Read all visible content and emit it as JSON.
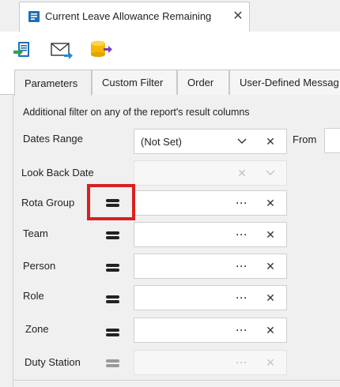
{
  "document_tab": {
    "title": "Current Leave Allowance Remaining",
    "close_glyph": "✕"
  },
  "toolbar": {
    "buttons": [
      {
        "name": "export-icon"
      },
      {
        "name": "email-icon"
      },
      {
        "name": "database-export-icon"
      }
    ]
  },
  "tabs": [
    {
      "label": "Parameters",
      "active": true
    },
    {
      "label": "Custom Filter",
      "active": false
    },
    {
      "label": "Order",
      "active": false
    },
    {
      "label": "User-Defined Messag",
      "active": false
    }
  ],
  "parameters": {
    "description": "Additional filter on any of the report's result columns",
    "dates_range": {
      "label": "Dates Range",
      "value": "(Not Set)",
      "from_label": "From"
    },
    "look_back_date": {
      "label": "Look Back Date",
      "value": ""
    },
    "rows": [
      {
        "label": "Rota Group",
        "value": ""
      },
      {
        "label": "Team",
        "value": ""
      },
      {
        "label": "Person",
        "value": ""
      },
      {
        "label": "Role",
        "value": ""
      },
      {
        "label": "Zone",
        "value": ""
      },
      {
        "label": "Duty Station",
        "value": ""
      }
    ],
    "ellipsis_glyph": "···",
    "clear_glyph": "✕",
    "dropdown_glyph": "⌄"
  },
  "colors": {
    "highlight": "#d9201f",
    "export_blue": "#1f8ad6",
    "export_green": "#2ea44f",
    "db_yellow": "#f5b800",
    "db_purple": "#7a3fb8"
  }
}
